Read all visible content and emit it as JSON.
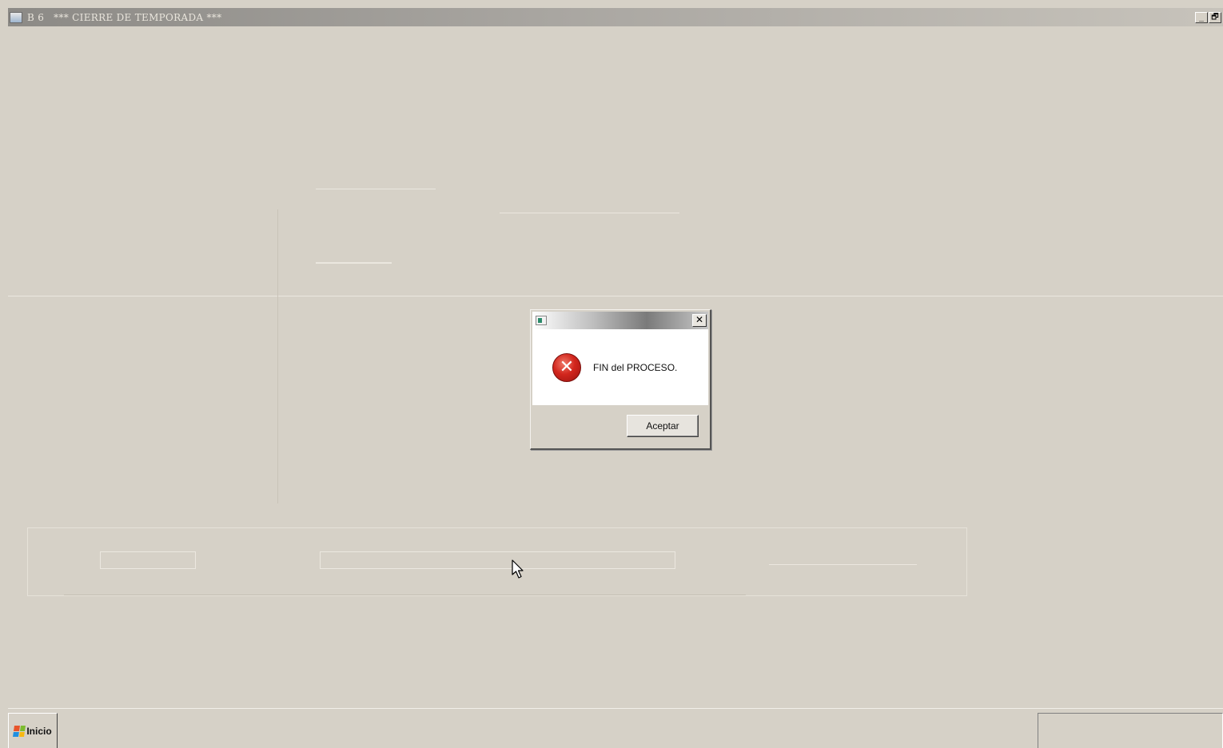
{
  "window": {
    "number": "B 6",
    "title": "*** CIERRE DE TEMPORADA ***",
    "minimize_glyph": "_",
    "restore_glyph": "🗗"
  },
  "dialog": {
    "close_glyph": "✕",
    "error_glyph": "✕",
    "message": "FIN del PROCESO.",
    "ok_label": "Aceptar"
  },
  "taskbar": {
    "start_label": "Inicio"
  },
  "icons": {
    "app": "app-icon",
    "dialog": "dialog-app-icon",
    "error": "error-icon",
    "cursor": "mouse-pointer-icon",
    "start": "windows-flag-icon"
  },
  "colors": {
    "desktop": "#d6d1c7",
    "error_red": "#d2261d"
  }
}
